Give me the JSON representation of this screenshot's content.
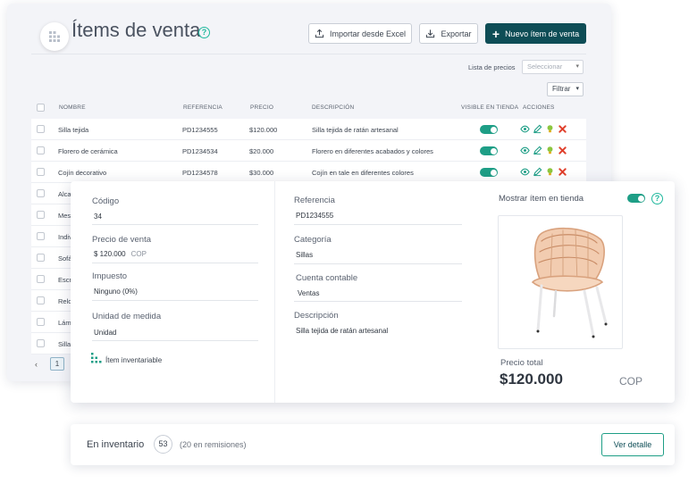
{
  "app": {
    "title": "Ítems de venta",
    "import_label": "Importar desde Excel",
    "export_label": "Exportar",
    "new_label": "Nuevo ítem de venta",
    "price_list_label": "Lista de precios",
    "price_list_placeholder": "Seleccionar",
    "filter_label": "Filtrar",
    "brand_color": "#0e4d56",
    "accent_color": "#1e9e86"
  },
  "table": {
    "headers": [
      "NOMBRE",
      "REFERENCIA",
      "PRECIO",
      "DESCRIPCIÓN",
      "VISIBLE EN TIENDA",
      "ACCIONES"
    ],
    "rows": [
      {
        "name": "Silla tejida",
        "ref": "PD1234555",
        "price": "$120.000",
        "desc": "Silla tejida de ratán artesanal",
        "visible": true
      },
      {
        "name": "Florero de cerámica",
        "ref": "PD1234534",
        "price": "$20.000",
        "desc": "Florero en diferentes acabados y colores",
        "visible": true
      },
      {
        "name": "Cojín decorativo",
        "ref": "PD1234578",
        "price": "$30.000",
        "desc": "Cojín en tale en diferentes colores",
        "visible": true
      }
    ],
    "partial_rows": [
      "Alca",
      "Mes",
      "Indiv",
      "Sofá",
      "Escr",
      "Relo",
      "Lám",
      "Silla"
    ],
    "actions": [
      "view-icon",
      "edit-icon",
      "lightbulb-icon",
      "delete-icon"
    ],
    "current_page": "1"
  },
  "detail": {
    "code_label": "Código",
    "code_value": "34",
    "price_label": "Precio de venta",
    "price_value": "$ 120.000",
    "price_currency": "COP",
    "tax_label": "Impuesto",
    "tax_value": "Ninguno (0%)",
    "unit_label": "Unidad de medida",
    "unit_value": "Unidad",
    "inventory_flag": "Ítem inventariable",
    "ref_label": "Referencia",
    "ref_value": "PD1234555",
    "category_label": "Categoría",
    "category_value": "Sillas",
    "account_label": "Cuenta contable",
    "account_value": "Ventas",
    "desc_label": "Descripción",
    "desc_value": "Silla tejida de ratán artesanal",
    "show_label": "Mostrar ítem en tienda",
    "show_enabled": true,
    "total_label": "Precio total",
    "total_value": "$120.000",
    "total_currency": "COP"
  },
  "inventory": {
    "label": "En inventario",
    "count": "53",
    "remissions": "(20 en remisiones)",
    "detail_button": "Ver detalle"
  }
}
